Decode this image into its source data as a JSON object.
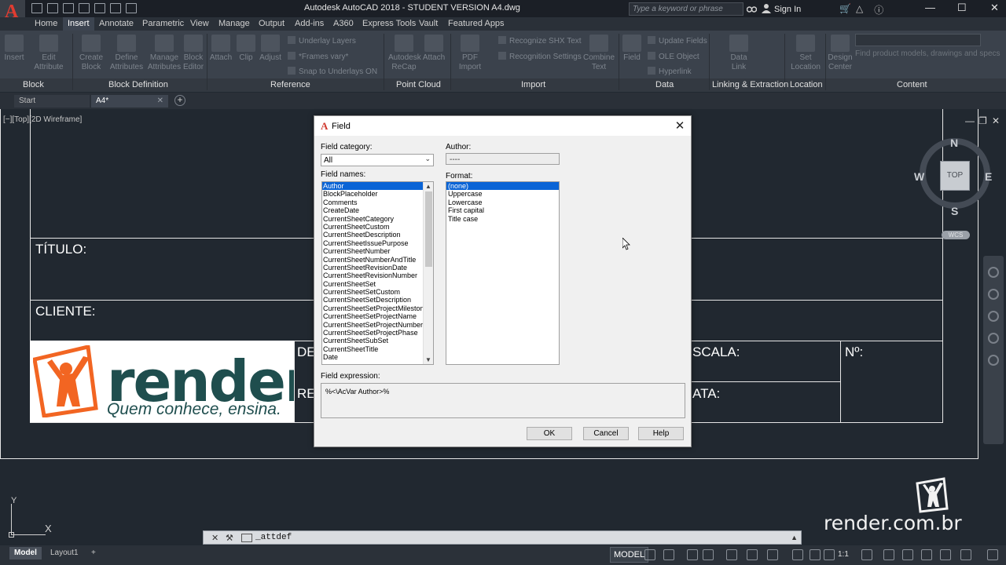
{
  "titlebar": {
    "app_letter": "A",
    "title": "Autodesk AutoCAD 2018 - STUDENT VERSION     A4.dwg",
    "search_placeholder": "Type a keyword or phrase",
    "sign_in": "Sign In"
  },
  "ribbon": {
    "tabs": [
      "Home",
      "Insert",
      "Annotate",
      "Parametric",
      "View",
      "Manage",
      "Output",
      "Add-ins",
      "A360",
      "Express Tools",
      "Vault",
      "Featured Apps"
    ],
    "active_tab": "Insert",
    "panels": [
      "Block",
      "Block Definition",
      "Reference",
      "Point Cloud",
      "Import",
      "Data",
      "Linking & Extraction",
      "Location",
      "Content"
    ],
    "buttons": {
      "insert": "Insert",
      "edit_attribute": "Edit Attribute",
      "create_block": "Create Block",
      "define_attributes": "Define Attributes",
      "manage_attributes": "Manage Attributes",
      "block_editor": "Block Editor",
      "attach": "Attach",
      "clip": "Clip",
      "adjust": "Adjust",
      "underlay_layers": "Underlay Layers",
      "frames_vary": "*Frames vary*",
      "snap_to_underlays": "Snap to Underlays ON",
      "autodesk_recap": "Autodesk ReCap",
      "attach_pc": "Attach",
      "pdf_import": "PDF Import",
      "recognize_shx": "Recognize SHX Text",
      "recognition_settings": "Recognition Settings",
      "combine_text": "Combine Text",
      "field": "Field",
      "update_fields": "Update Fields",
      "ole_object": "OLE Object",
      "hyperlink": "Hyperlink",
      "data_link": "Data Link",
      "set_location": "Set Location",
      "design_center": "Design Center",
      "content_hint": "Find product models, drawings and specs"
    }
  },
  "file_tabs": {
    "start": "Start",
    "active": "A4*"
  },
  "viewport": {
    "label": "[−][Top][2D Wireframe]",
    "compass": {
      "n": "N",
      "s": "S",
      "e": "E",
      "w": "W",
      "face": "TOP",
      "wcs": "WCS"
    }
  },
  "drawing": {
    "titulo": "TÍTULO:",
    "cliente": "CLIENTE:",
    "de": "DE",
    "re": "RE",
    "escala": "SCALA:",
    "data": "ATA:",
    "numero": "Nº:",
    "logo_word": "render",
    "logo_tagline": "Quem conhece, ensina."
  },
  "dialog": {
    "title": "Field",
    "field_category_label": "Field category:",
    "field_category_value": "All",
    "author_label": "Author:",
    "author_value": "----",
    "field_names_label": "Field names:",
    "field_names": [
      "Author",
      "BlockPlaceholder",
      "Comments",
      "CreateDate",
      "CurrentSheetCategory",
      "CurrentSheetCustom",
      "CurrentSheetDescription",
      "CurrentSheetIssuePurpose",
      "CurrentSheetNumber",
      "CurrentSheetNumberAndTitle",
      "CurrentSheetRevisionDate",
      "CurrentSheetRevisionNumber",
      "CurrentSheetSet",
      "CurrentSheetSetCustom",
      "CurrentSheetSetDescription",
      "CurrentSheetSetProjectMilestone",
      "CurrentSheetSetProjectName",
      "CurrentSheetSetProjectNumber",
      "CurrentSheetSetProjectPhase",
      "CurrentSheetSubSet",
      "CurrentSheetTitle",
      "Date"
    ],
    "selected_field": "Author",
    "format_label": "Format:",
    "formats": [
      "(none)",
      "Uppercase",
      "Lowercase",
      "First capital",
      "Title case"
    ],
    "selected_format": "(none)",
    "field_expression_label": "Field expression:",
    "field_expression": "%<\\AcVar Author>%",
    "ok": "OK",
    "cancel": "Cancel",
    "help": "Help"
  },
  "ucs": {
    "x": "X",
    "y": "Y"
  },
  "command_line": {
    "text": "_attdef"
  },
  "watermark": "render.com.br",
  "status": {
    "model_tab": "Model",
    "layout_tab": "Layout1",
    "model_button": "MODEL",
    "scale": "1:1"
  }
}
